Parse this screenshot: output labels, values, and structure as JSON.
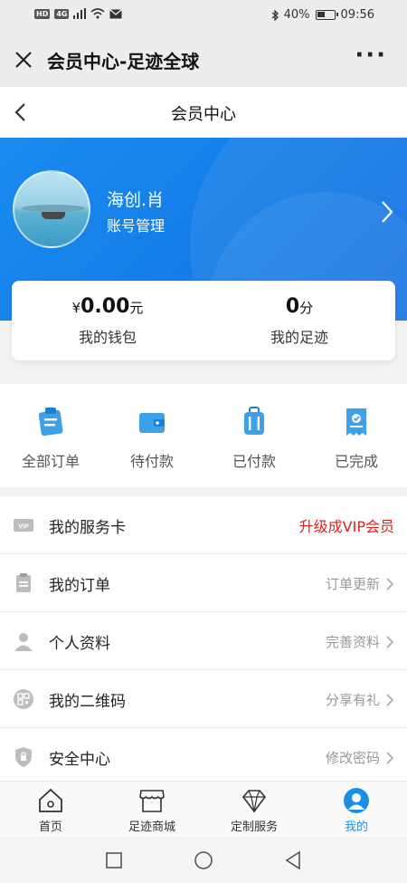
{
  "status_bar": {
    "left_badges": [
      "HD",
      "4G"
    ],
    "battery": "40%",
    "time": "09:56"
  },
  "wechat_bar": {
    "title": "会员中心-足迹全球"
  },
  "page_header": {
    "title": "会员中心"
  },
  "profile": {
    "name": "海创.肖",
    "account_link": "账号管理"
  },
  "wallet": {
    "balance_prefix": "¥",
    "balance": "0.00",
    "balance_unit": "元",
    "balance_label": "我的钱包",
    "footprint": "0",
    "footprint_unit": "分",
    "footprint_label": "我的足迹"
  },
  "orders": [
    {
      "label": "全部订单",
      "icon": "clipboard-icon"
    },
    {
      "label": "待付款",
      "icon": "wallet-icon"
    },
    {
      "label": "已付款",
      "icon": "luggage-icon"
    },
    {
      "label": "已完成",
      "icon": "receipt-check-icon"
    }
  ],
  "menu": [
    {
      "label": "我的服务卡",
      "right": "升级成VIP会员",
      "icon": "vip-card-icon"
    },
    {
      "label": "我的订单",
      "right": "订单更新",
      "icon": "order-list-icon"
    },
    {
      "label": "个人资料",
      "right": "完善资料",
      "icon": "person-icon"
    },
    {
      "label": "我的二维码",
      "right": "分享有礼",
      "icon": "qrcode-icon"
    },
    {
      "label": "安全中心",
      "right": "修改密码",
      "icon": "shield-icon"
    }
  ],
  "tabs": [
    {
      "label": "首页",
      "icon": "home-icon"
    },
    {
      "label": "足迹商城",
      "icon": "store-icon"
    },
    {
      "label": "定制服务",
      "icon": "diamond-icon"
    },
    {
      "label": "我的",
      "icon": "profile-icon",
      "active": true
    }
  ],
  "colors": {
    "accent": "#1a8fe8",
    "banner": "#1a8cf0",
    "vip_red": "#dd2222"
  }
}
